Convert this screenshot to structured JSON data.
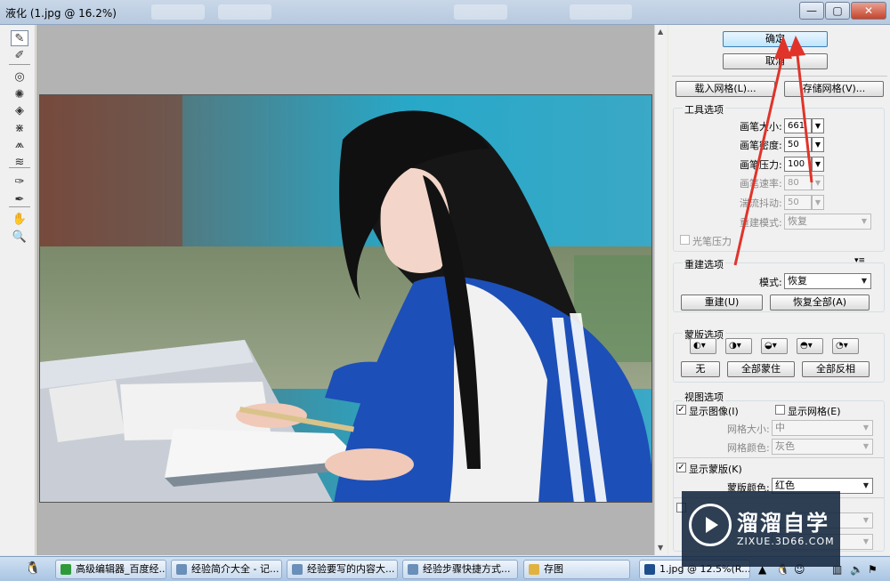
{
  "window": {
    "title": "液化 (1.jpg @ 16.2%)",
    "minimize": "—",
    "maximize": "▢",
    "close": "✕"
  },
  "tools": [
    {
      "name": "forward-warp-tool",
      "glyph": "✎"
    },
    {
      "name": "reconstruct-tool",
      "glyph": "✐"
    },
    {
      "name": "twirl-clockwise-tool",
      "glyph": "◎"
    },
    {
      "name": "pucker-tool",
      "glyph": "✺"
    },
    {
      "name": "bloat-tool",
      "glyph": "◈"
    },
    {
      "name": "push-left-tool",
      "glyph": "⋇"
    },
    {
      "name": "mirror-tool",
      "glyph": "⩕"
    },
    {
      "name": "turbulence-tool",
      "glyph": "≋"
    },
    {
      "name": "freeze-mask-tool",
      "glyph": "✑"
    },
    {
      "name": "thaw-mask-tool",
      "glyph": "✒"
    },
    {
      "name": "hand-tool",
      "glyph": "✋"
    },
    {
      "name": "zoom-tool",
      "glyph": "🔍"
    }
  ],
  "buttons": {
    "ok": "确定",
    "cancel": "取消",
    "load_mesh": "载入网格(L)...",
    "save_mesh": "存储网格(V)...",
    "reconstruct": "重建(U)",
    "restore_all": "恢复全部(A)",
    "none": "无",
    "mask_all": "全部蒙住",
    "invert_all": "全部反相"
  },
  "tool_options": {
    "title": "工具选项",
    "brush_size_label": "画笔大小:",
    "brush_size": "661",
    "brush_density_label": "画笔密度:",
    "brush_density": "50",
    "brush_pressure_label": "画笔压力:",
    "brush_pressure": "100",
    "brush_rate_label": "画笔速率:",
    "brush_rate": "80",
    "turbulent_jitter_label": "湍流抖动:",
    "turbulent_jitter": "50",
    "reconstruct_mode_label": "重建模式:",
    "reconstruct_mode": "恢复",
    "stylus_pressure": "光笔压力"
  },
  "reconstruct_options": {
    "title": "重建选项",
    "mode_label": "模式:",
    "mode": "恢复"
  },
  "mask_options": {
    "title": "蒙版选项"
  },
  "view_options": {
    "title": "视图选项",
    "show_image": "显示图像(I)",
    "show_mesh": "显示网格(E)",
    "mesh_size_label": "网格大小:",
    "mesh_size": "中",
    "mesh_color_label": "网格颜色:",
    "mesh_color": "灰色",
    "show_mask": "显示蒙版(K)",
    "mask_color_label": "蒙版颜色:",
    "mask_color": "红色"
  },
  "taskbar": {
    "items": [
      {
        "label": "高级编辑器_百度经...",
        "color": "#2f9a3a"
      },
      {
        "label": "经验简介大全 - 记...",
        "color": "#6a8fb8"
      },
      {
        "label": "经验要写的内容大...",
        "color": "#6a8fb8"
      },
      {
        "label": "经验步骤快捷方式...",
        "color": "#6a8fb8"
      },
      {
        "label": "存图",
        "color": "#e0b341"
      },
      {
        "label": "1.jpg @ 12.5%(R...",
        "color": "#1f4e8c"
      }
    ]
  },
  "watermark": {
    "brand": "溜溜自学",
    "url": "ZIXUE.3D66.COM"
  },
  "colors": {
    "annotation_arrow": "#e0342a",
    "canvas_bg": "#b3b3b3",
    "panel_bg": "#f0f0f0"
  }
}
